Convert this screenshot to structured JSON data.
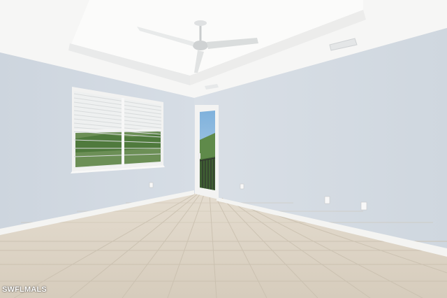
{
  "photo": {
    "subject": "empty-room",
    "watermark": "SWFLMALS"
  },
  "colors": {
    "wall": "#d3dbe3",
    "ceiling": "#f7f7f6",
    "tile": "#ddd3c5",
    "baseboard": "#f5f5f3",
    "sky": "#8fb8dd",
    "trees": "#5f8a4a"
  }
}
